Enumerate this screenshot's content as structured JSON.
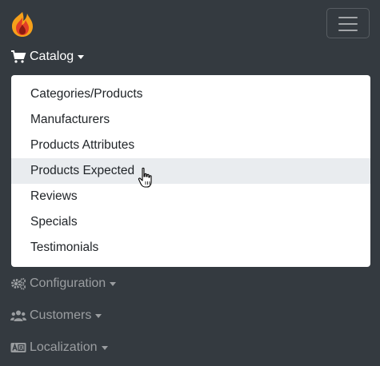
{
  "nav": {
    "catalog_label": "Catalog",
    "configuration_label": "Configuration",
    "customers_label": "Customers",
    "localization_label": "Localization"
  },
  "dropdown": {
    "items": [
      "Categories/Products",
      "Manufacturers",
      "Products Attributes",
      "Products Expected",
      "Reviews",
      "Specials",
      "Testimonials"
    ],
    "hovered_item": "Products Expected"
  },
  "icons": {
    "logo": "flame-logo",
    "toggler": "hamburger-icon",
    "catalog": "shopping-cart-icon",
    "configuration": "gears-icon",
    "customers": "users-icon",
    "localization": "language-icon",
    "cursor": "hand-pointer-cursor"
  },
  "colors": {
    "navbar_bg": "#343a40",
    "dropdown_bg": "#ffffff",
    "hover_bg": "#e9ecef",
    "logo_orange": "#f6a01a",
    "logo_red": "#e23d28"
  }
}
